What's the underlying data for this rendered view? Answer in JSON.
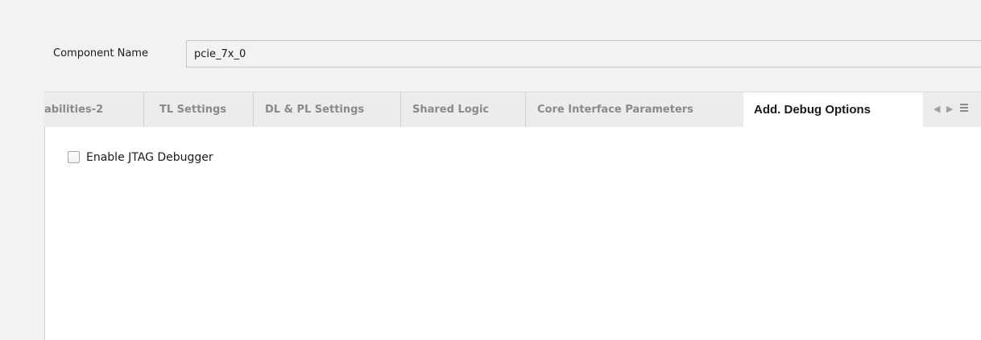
{
  "component": {
    "label": "Component Name",
    "value": "pcie_7x_0"
  },
  "tabs": [
    {
      "label": "abilities-2",
      "active": false
    },
    {
      "label": "TL Settings",
      "active": false
    },
    {
      "label": "DL & PL Settings",
      "active": false
    },
    {
      "label": "Shared Logic",
      "active": false
    },
    {
      "label": "Core Interface Parameters",
      "active": false
    },
    {
      "label": "Add. Debug Options",
      "active": true
    }
  ],
  "tab_nav": {
    "left_icon": "chevron-left-icon",
    "right_icon": "chevron-right-icon",
    "menu_icon": "menu-icon"
  },
  "options": {
    "enable_jtag_debugger": {
      "label": "Enable JTAG Debugger",
      "checked": false
    }
  }
}
